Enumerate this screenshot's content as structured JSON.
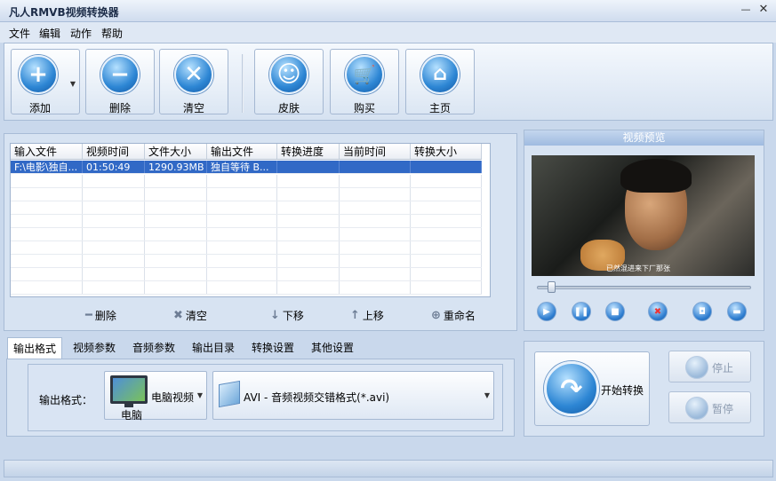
{
  "window": {
    "title": "凡人RMVB视频转换器",
    "minimize": "—",
    "close": "✕"
  },
  "menu": [
    "文件",
    "编辑",
    "动作",
    "帮助"
  ],
  "toolbar": {
    "add": "添加",
    "delete": "删除",
    "clear": "清空",
    "skin": "皮肤",
    "buy": "购买",
    "home": "主页"
  },
  "file_list": {
    "columns": [
      "输入文件",
      "视频时间",
      "文件大小",
      "输出文件",
      "转换进度",
      "当前时间",
      "转换大小"
    ],
    "rows": [
      [
        "F:\\电影\\独自...",
        "01:50:49",
        "1290.93MB",
        "独自等待 B...",
        "",
        "",
        ""
      ]
    ],
    "actions": {
      "delete": "删除",
      "clear": "清空",
      "move_down": "下移",
      "move_up": "上移",
      "rename": "重命名"
    }
  },
  "preview": {
    "title": "视频预览",
    "subtitle": "已然混进来下厂那张",
    "progress": 0.05
  },
  "tabs": [
    "输出格式",
    "视频参数",
    "音频参数",
    "输出目录",
    "转换设置",
    "其他设置"
  ],
  "output": {
    "label": "输出格式：",
    "device": "电脑视频",
    "device_sub": "电脑",
    "format": "AVI - 音频视频交错格式(*.avi)"
  },
  "convert": {
    "start": "开始转换",
    "stop": "停止",
    "pause": "暂停"
  }
}
